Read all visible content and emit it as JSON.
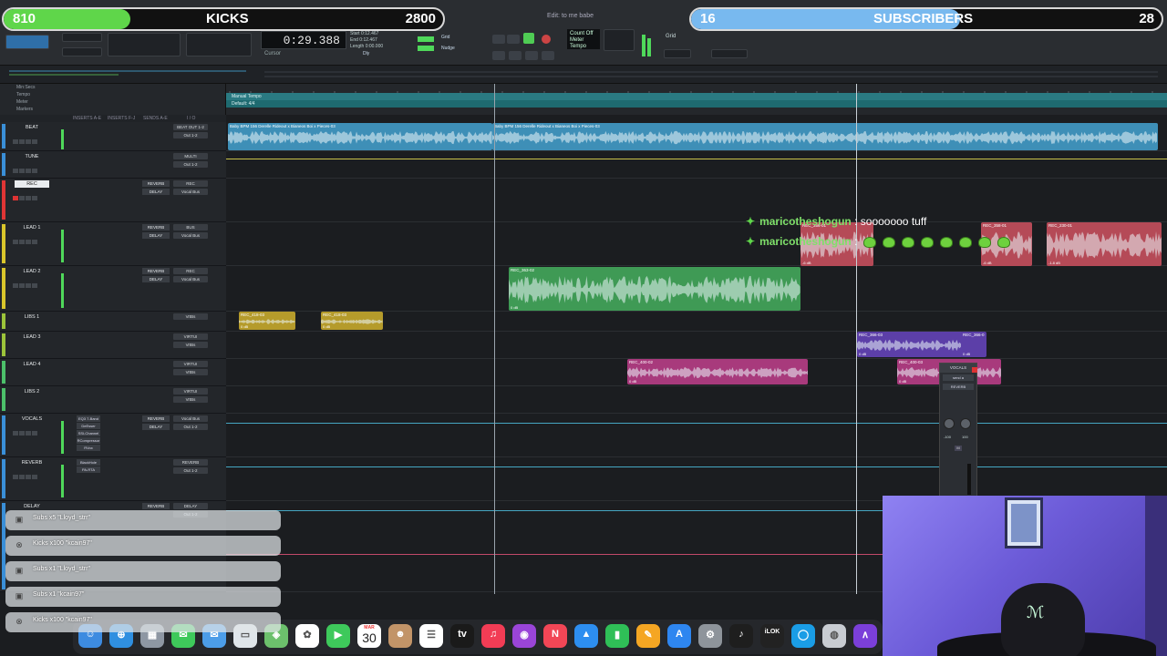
{
  "goals": {
    "kicks": {
      "current": "810",
      "label": "KICKS",
      "target": "2800",
      "progress": 0.289,
      "color": "#5fd64a"
    },
    "subscribers": {
      "current": "16",
      "label": "SUBSCRIBERS",
      "target": "28",
      "progress": 0.571,
      "color": "#78b9ef"
    }
  },
  "toolbar": {
    "edit_window_title": "Edit: to me babe",
    "main_counter": "0:29.388",
    "cursor_label": "Cursor",
    "selection": {
      "start_label": "Start",
      "start": "0:12.467",
      "end_label": "End",
      "end": "0:12.467",
      "length_label": "Length",
      "length": "0:00.000"
    },
    "grid_label": "Grid",
    "nudge_label": "Nudge",
    "count_off": "Count Off",
    "meter": "Meter",
    "tempo": "Tempo",
    "dly_label": "Dly"
  },
  "rulers": {
    "min_secs": "Min:Secs",
    "tempo": "Tempo",
    "meter": "Meter",
    "markers": "Markers",
    "tempo_value": "Manual Tempo",
    "meter_value": "Default: 4/4"
  },
  "column_headers": {
    "inserts_ae": "INSERTS A-E",
    "inserts_fj": "INSERTS F-J",
    "sends_ae": "SENDS A-E",
    "io": "I / O"
  },
  "tracks": [
    {
      "name": "BEAT",
      "color": "#3a8fd8",
      "io": [
        "BEAT OUT 1-2",
        "Out 1-2"
      ],
      "sends": [],
      "inserts": []
    },
    {
      "name": "TUNE",
      "color": "#3a8fd8",
      "io": [
        "MULTI",
        "Out 1-2"
      ],
      "sends": [],
      "inserts": []
    },
    {
      "name": "REC",
      "color": "#e03535",
      "io": [
        "REC",
        "Vocal Bus"
      ],
      "sends": [
        "REVERB",
        "DELAY"
      ],
      "inserts": []
    },
    {
      "name": "LEAD 1",
      "color": "#d9c62b",
      "io": [
        "BUS",
        "Vocal Bus"
      ],
      "sends": [
        "REVERB",
        "DELAY"
      ],
      "inserts": []
    },
    {
      "name": "LEAD 2",
      "color": "#d9c62b",
      "io": [
        "REC",
        "Vocal Bus"
      ],
      "sends": [
        "REVERB",
        "DELAY"
      ],
      "inserts": []
    },
    {
      "name": "LIBS 1",
      "color": "#9cc43a",
      "io": [
        "VrtBs"
      ],
      "sends": [],
      "inserts": []
    },
    {
      "name": "LEAD 3",
      "color": "#9cc43a",
      "io": [
        "VIRTUI",
        "VrtBs"
      ],
      "sends": [],
      "inserts": []
    },
    {
      "name": "LEAD 4",
      "color": "#4cc06a",
      "io": [
        "VIRTUI",
        "VrtBs"
      ],
      "sends": [],
      "inserts": []
    },
    {
      "name": "LIBS 2",
      "color": "#4cc06a",
      "io": [
        "VIRTUI",
        "VrtBs"
      ],
      "sends": [],
      "inserts": []
    },
    {
      "name": "VOCALS",
      "color": "#3a8fd8",
      "io": [
        "Vocal Bus",
        "Out 1-2"
      ],
      "sends": [
        "REVERB",
        "DELAY"
      ],
      "inserts": [
        "EQ3 7-Band",
        "DeEsser",
        "SSLChannel",
        "RCompressor",
        "RVox"
      ]
    },
    {
      "name": "REVERB",
      "color": "#3a8fd8",
      "io": [
        "REVERB",
        "Out 1-2"
      ],
      "sends": [],
      "inserts": [
        "BlackHole",
        "PA-RTA"
      ]
    },
    {
      "name": "DELAY",
      "color": "#3a8fd8",
      "io": [
        "DELAY",
        "Out 1-2"
      ],
      "sends": [
        "REVERB"
      ],
      "inserts": []
    }
  ],
  "clips": {
    "beat_a": {
      "name": "Baby BPM 156 Derelle Rideout x Bianeos Boi x Pieces-03",
      "color": "#3e8fb7"
    },
    "beat_b": {
      "name": "Baby BPM 156 Derelle Rideout x Bianeos Boi x Pieces-03",
      "color": "#3e8fb7"
    },
    "lead1_a": {
      "name": "REC_356-01",
      "gain": "-6 dB",
      "color": "#b54a57"
    },
    "lead1_b": {
      "name": "REC_358-01",
      "gain": "-6 dB",
      "color": "#b54a57"
    },
    "lead1_c": {
      "name": "REC_230-01",
      "gain": "-1.8 dB",
      "color": "#b54a57"
    },
    "lead2": {
      "name": "REC_363-02",
      "gain": "0 dB",
      "color": "#3f9a55"
    },
    "libs1_a": {
      "name": "REC_418-03",
      "gain": "0 dB",
      "color": "#b59b2b"
    },
    "libs1_b": {
      "name": "REC_418-03",
      "gain": "0 dB",
      "color": "#b59b2b"
    },
    "lead3_a": {
      "name": "REC_366-03",
      "gain": "0 dB",
      "color": "#5c3fa8"
    },
    "lead3_b": {
      "name": "REC_366-0",
      "gain": "0 dB",
      "color": "#5c3fa8"
    },
    "lead4_a": {
      "name": "REC_400-02",
      "gain": "0 dB",
      "color": "#a83a7c"
    },
    "lead4_b": {
      "name": "REC_400-03",
      "gain": "0 dB",
      "color": "#a83a7c"
    }
  },
  "chat": [
    {
      "user": "maricotheshogun",
      "message": "sooooooo tuff",
      "emotes": 0
    },
    {
      "user": "maricotheshogun",
      "message": "",
      "emotes": 8
    }
  ],
  "mixer": {
    "track": "VOCALS",
    "sends": "send a",
    "fx": "REVERB",
    "in_val": "-100",
    "out_val": "100",
    "m_label": "M"
  },
  "alerts": [
    {
      "icon": "gift-icon",
      "glyph": "▣",
      "text": "Subs x5 \"Lloyd_strr\""
    },
    {
      "icon": "kick-icon",
      "glyph": "⊗",
      "text": "Kicks x100 \"kcain97\""
    },
    {
      "icon": "gift-icon",
      "glyph": "▣",
      "text": "Subs x1 \"Lloyd_strr\""
    },
    {
      "icon": "gift-icon",
      "glyph": "▣",
      "text": "Subs x1 \"kcain97\""
    },
    {
      "icon": "kick-icon",
      "glyph": "⊗",
      "text": "Kicks x100 \"kcain97\""
    }
  ],
  "dock": {
    "calendar_month": "MAR",
    "calendar_day": "30",
    "apps": [
      {
        "name": "finder-icon",
        "color": "#3d8be0",
        "glyph": "☺"
      },
      {
        "name": "safari-icon",
        "color": "#2f8fe0",
        "glyph": "⊕"
      },
      {
        "name": "launchpad-icon",
        "color": "#8e97a3",
        "glyph": "▦"
      },
      {
        "name": "messages-icon",
        "color": "#3ec95b",
        "glyph": "✉"
      },
      {
        "name": "mail-icon",
        "color": "#4c9de8",
        "glyph": "✉"
      },
      {
        "name": "files-icon",
        "color": "#dfe5ea",
        "glyph": "▭"
      },
      {
        "name": "maps-icon",
        "color": "#6cc06c",
        "glyph": "◈"
      },
      {
        "name": "photos-icon",
        "color": "#ffffff",
        "glyph": "✿"
      },
      {
        "name": "facetime-icon",
        "color": "#3ec95b",
        "glyph": "▶"
      },
      {
        "name": "calendar-icon",
        "color": "#ffffff",
        "glyph": ""
      },
      {
        "name": "contacts-icon",
        "color": "#c29468",
        "glyph": "☻"
      },
      {
        "name": "reminders-icon",
        "color": "#ffffff",
        "glyph": "☰"
      },
      {
        "name": "appletv-icon",
        "color": "#1a1a1a",
        "glyph": "tv"
      },
      {
        "name": "music-icon",
        "color": "#f23c55",
        "glyph": "♫"
      },
      {
        "name": "podcasts-icon",
        "color": "#9a45d8",
        "glyph": "◉"
      },
      {
        "name": "news-icon",
        "color": "#f24656",
        "glyph": "N"
      },
      {
        "name": "keynote-icon",
        "color": "#2d8ef0",
        "glyph": "▲"
      },
      {
        "name": "numbers-icon",
        "color": "#2fbf57",
        "glyph": "▮"
      },
      {
        "name": "pages-icon",
        "color": "#f5a623",
        "glyph": "✎"
      },
      {
        "name": "appstore-icon",
        "color": "#2e86f0",
        "glyph": "A"
      },
      {
        "name": "settings-icon",
        "color": "#8e949b",
        "glyph": "⚙"
      },
      {
        "name": "logic-icon",
        "color": "#1e1e1e",
        "glyph": "♪"
      },
      {
        "name": "ilok-icon",
        "color": "#222222",
        "glyph": "iLOK"
      },
      {
        "name": "protools-icon",
        "color": "#1a9de6",
        "glyph": "◯"
      },
      {
        "name": "utility-icon",
        "color": "#c8ccd2",
        "glyph": "◍"
      },
      {
        "name": "plugin-icon",
        "color": "#7b3fd9",
        "glyph": "∧"
      }
    ]
  }
}
